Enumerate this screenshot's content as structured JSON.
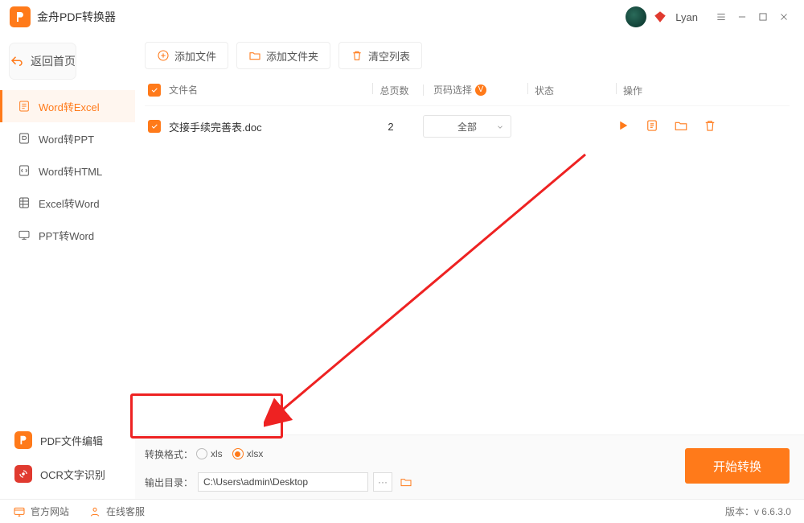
{
  "app": {
    "title": "金舟PDF转换器",
    "username": "Lyan",
    "version_label": "版本：v 6.6.3.0"
  },
  "sidebar": {
    "back_label": "返回首页",
    "items": [
      {
        "label": "Word转Excel"
      },
      {
        "label": "Word转PPT"
      },
      {
        "label": "Word转HTML"
      },
      {
        "label": "Excel转Word"
      },
      {
        "label": "PPT转Word"
      }
    ],
    "tools": [
      {
        "label": "PDF文件编辑"
      },
      {
        "label": "OCR文字识别"
      }
    ]
  },
  "toolbar": {
    "add_file": "添加文件",
    "add_folder": "添加文件夹",
    "clear_list": "清空列表"
  },
  "table": {
    "headers": {
      "filename": "文件名",
      "pages": "总页数",
      "page_select": "页码选择",
      "status": "状态",
      "ops": "操作"
    },
    "rows": [
      {
        "filename": "交接手续完善表.doc",
        "pages": "2",
        "page_select": "全部"
      }
    ]
  },
  "bottom": {
    "fmt_label": "转换格式：",
    "opt_xls": "xls",
    "opt_xlsx": "xlsx",
    "out_label": "输出目录：",
    "out_path": "C:\\Users\\admin\\Desktop",
    "start": "开始转换"
  },
  "footer": {
    "site": "官方网站",
    "support": "在线客服"
  }
}
